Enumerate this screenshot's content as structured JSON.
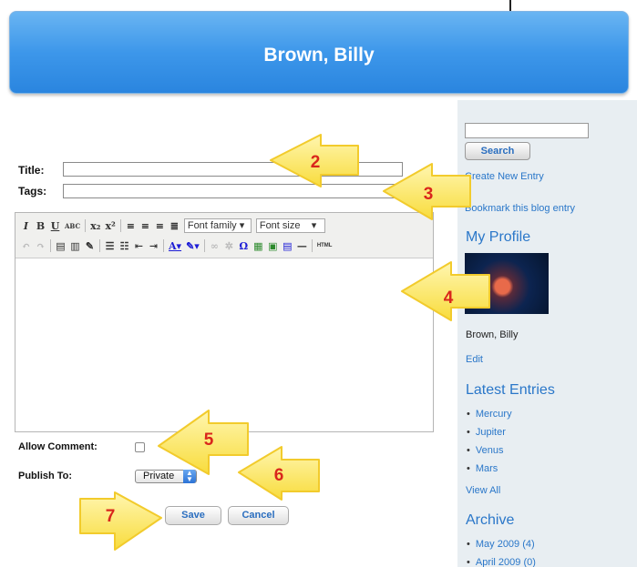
{
  "header": {
    "title": "Brown, Billy"
  },
  "sidebar": {
    "search_button": "Search",
    "links": {
      "create_entry": "Create New Entry",
      "bookmark": "Bookmark this blog entry"
    },
    "profile": {
      "heading": "My Profile",
      "name": "Brown, Billy",
      "edit": "Edit"
    },
    "latest": {
      "heading": "Latest Entries",
      "items": [
        "Mercury",
        "Jupiter",
        "Venus",
        "Mars"
      ],
      "view_all": "View All"
    },
    "archive": {
      "heading": "Archive",
      "items": [
        "May 2009 (4)",
        "April 2009 (0)"
      ]
    }
  },
  "form": {
    "title_label": "Title:",
    "tags_label": "Tags:",
    "title_value": "",
    "tags_value": "",
    "allow_comment_label": "Allow Comment:",
    "allow_comment_checked": false,
    "publish_label": "Publish To:",
    "publish_value": "Private",
    "save_label": "Save",
    "cancel_label": "Cancel"
  },
  "editor": {
    "font_family": "Font family",
    "font_size": "Font size",
    "html_label": "HTML",
    "content": ""
  },
  "callouts": [
    "2",
    "3",
    "4",
    "5",
    "6",
    "7"
  ],
  "colors": {
    "header": "#3d97ea",
    "link": "#2a77c9",
    "callout_fill": "#fbe561",
    "callout_text": "#d9261c"
  },
  "icons": [
    "italic-icon",
    "bold-icon",
    "underline-icon",
    "spellcheck-icon",
    "subscript-icon",
    "superscript-icon",
    "align-left-icon",
    "align-center-icon",
    "align-right-icon",
    "justify-icon",
    "undo-icon",
    "redo-icon",
    "paste-icon",
    "paste-word-icon",
    "cleanup-icon",
    "bullet-list-icon",
    "numbered-list-icon",
    "outdent-icon",
    "indent-icon",
    "text-color-icon",
    "highlight-icon",
    "link-icon",
    "unlink-icon",
    "special-char-icon",
    "media-icon",
    "image-icon",
    "template-icon",
    "horizontal-rule-icon"
  ]
}
